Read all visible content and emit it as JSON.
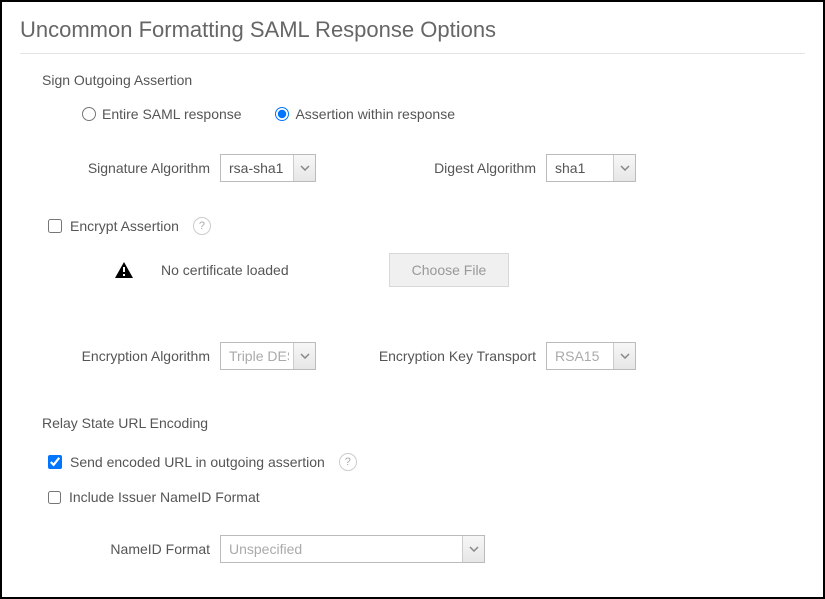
{
  "title": "Uncommon Formatting SAML Response Options",
  "sign_section": {
    "heading": "Sign Outgoing Assertion",
    "radio_entire": "Entire SAML response",
    "radio_assertion": "Assertion within response",
    "selected": "assertion",
    "sig_algo_label": "Signature Algorithm",
    "sig_algo_value": "rsa-sha1",
    "digest_algo_label": "Digest Algorithm",
    "digest_algo_value": "sha1"
  },
  "encrypt_section": {
    "checkbox_label": "Encrypt Assertion",
    "checked": false,
    "no_cert_text": "No certificate loaded",
    "choose_file_label": "Choose File",
    "enc_algo_label": "Encryption Algorithm",
    "enc_algo_value": "Triple DES",
    "key_transport_label": "Encryption Key Transport",
    "key_transport_value": "RSA15"
  },
  "relay_section": {
    "heading": "Relay State URL Encoding",
    "send_encoded_label": "Send encoded URL in outgoing assertion",
    "send_encoded_checked": true,
    "include_issuer_label": "Include Issuer NameID Format",
    "include_issuer_checked": false,
    "nameid_label": "NameID Format",
    "nameid_value": "Unspecified"
  }
}
